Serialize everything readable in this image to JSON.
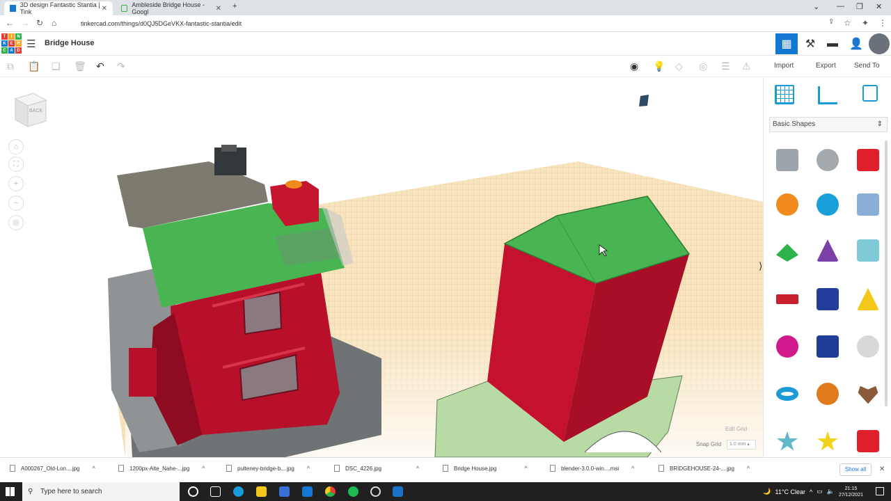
{
  "browser": {
    "tabs": [
      {
        "title": "3D design Fantastic Stantia | Tink",
        "active": true
      },
      {
        "title": "Ambleside Bridge House - Googl",
        "active": false
      }
    ],
    "new_tab": "+",
    "url": "tinkercad.com/things/d0QJ5DGeVKX-fantastic-stantia/edit"
  },
  "header": {
    "logo_letters": [
      "T",
      "I",
      "N",
      "K",
      "E",
      "R",
      "C",
      "A",
      "D"
    ],
    "title": "Bridge House"
  },
  "toolbar": {
    "import_label": "Import",
    "export_label": "Export",
    "sendto_label": "Send To"
  },
  "viewcube": {
    "face_label": "BACK"
  },
  "panel": {
    "shape_category": "Basic Shapes",
    "shapes": [
      {
        "name": "box-striped",
        "color": "#9ea4ab"
      },
      {
        "name": "cylinder-striped",
        "color": "#a4a9ae"
      },
      {
        "name": "box",
        "color": "#e01f2d"
      },
      {
        "name": "cylinder",
        "color": "#f08a1c"
      },
      {
        "name": "sphere",
        "color": "#1aa0d8"
      },
      {
        "name": "scribble",
        "color": "#8ab0d8"
      },
      {
        "name": "roof",
        "color": "#2db34a"
      },
      {
        "name": "cone",
        "color": "#7b3fa8"
      },
      {
        "name": "round-roof",
        "color": "#7ecad6"
      },
      {
        "name": "text",
        "color": "#c8202c"
      },
      {
        "name": "wedge-box",
        "color": "#223e9a"
      },
      {
        "name": "pyramid",
        "color": "#f2c81a"
      },
      {
        "name": "half-sphere",
        "color": "#d01a8c"
      },
      {
        "name": "polygon",
        "color": "#1f3c96"
      },
      {
        "name": "paraboloid",
        "color": "#d8d8d8"
      },
      {
        "name": "torus",
        "color": "#1a9ad8"
      },
      {
        "name": "tube",
        "color": "#e07a1a"
      },
      {
        "name": "heart",
        "color": "#8a5a3a"
      },
      {
        "name": "star",
        "color": "#62b8c8"
      },
      {
        "name": "star-yellow",
        "color": "#f2d21a"
      },
      {
        "name": "icosahedron",
        "color": "#e01f2d"
      }
    ]
  },
  "workplane": {
    "edit_grid": "Edit Grid",
    "snap_label": "Snap Grid",
    "snap_value": "1.0 mm ▴"
  },
  "downloads": {
    "items": [
      "A000267_Old-Lon....jpg",
      "1200px-Alte_Nahe-...jpg",
      "pulteney-bridge-b....jpg",
      "DSC_4226.jpg",
      "Bridge House.jpg",
      "blender-3.0.0-win....msi",
      "BRIDGEHOUSE-24-....jpg"
    ],
    "show_all": "Show all",
    "close": "✕"
  },
  "taskbar": {
    "search_placeholder": "Type here to search",
    "weather": "11°C  Clear",
    "time": "21:15",
    "date": "27/12/2021"
  },
  "colors": {
    "tinker_blue": "#1477d1",
    "house_red": "#b8102a",
    "roof_green": "#3fae49",
    "grid_orange": "#f7d9a4"
  }
}
